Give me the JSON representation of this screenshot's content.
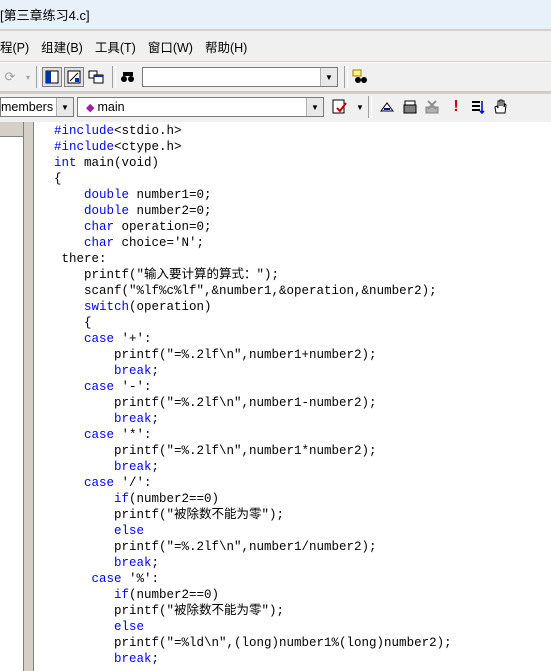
{
  "window": {
    "title": "[第三章练习4.c]"
  },
  "menu": [
    {
      "label": "程(P)"
    },
    {
      "label": "组建(B)"
    },
    {
      "label": "工具(T)"
    },
    {
      "label": "窗口(W)"
    },
    {
      "label": "帮助(H)"
    }
  ],
  "toolbar": {
    "find_combo_value": "",
    "members_combo_value": "members",
    "function_combo_value": "main"
  },
  "code_lines": [
    {
      "indent": "",
      "kw": "#include",
      "rest": "<stdio.h>"
    },
    {
      "indent": "",
      "kw": "#include",
      "rest": "<ctype.h>"
    },
    {
      "indent": "",
      "kw": "int",
      "rest": " main(void)"
    },
    {
      "indent": "",
      "kw": "",
      "rest": "{"
    },
    {
      "indent": "    ",
      "kw": "double",
      "rest": " number1=0;"
    },
    {
      "indent": "    ",
      "kw": "double",
      "rest": " number2=0;"
    },
    {
      "indent": "    ",
      "kw": "char",
      "rest": " operation=0;"
    },
    {
      "indent": "    ",
      "kw": "char",
      "rest": " choice='N';"
    },
    {
      "indent": " ",
      "kw": "",
      "rest": "there:"
    },
    {
      "indent": "    ",
      "kw": "",
      "rest": "printf(\"输入要计算的算式：\");"
    },
    {
      "indent": "    ",
      "kw": "",
      "rest": "scanf(\"%lf%c%lf\",&number1,&operation,&number2);"
    },
    {
      "indent": "    ",
      "kw": "switch",
      "rest": "(operation)"
    },
    {
      "indent": "    ",
      "kw": "",
      "rest": "{"
    },
    {
      "indent": "    ",
      "kw": "case",
      "rest": " '+':"
    },
    {
      "indent": "        ",
      "kw": "",
      "rest": "printf(\"=%.2lf\\n\",number1+number2);"
    },
    {
      "indent": "        ",
      "kw": "break",
      "rest": ";"
    },
    {
      "indent": "    ",
      "kw": "case",
      "rest": " '-':"
    },
    {
      "indent": "        ",
      "kw": "",
      "rest": "printf(\"=%.2lf\\n\",number1-number2);"
    },
    {
      "indent": "        ",
      "kw": "break",
      "rest": ";"
    },
    {
      "indent": "    ",
      "kw": "case",
      "rest": " '*':"
    },
    {
      "indent": "        ",
      "kw": "",
      "rest": "printf(\"=%.2lf\\n\",number1*number2);"
    },
    {
      "indent": "        ",
      "kw": "break",
      "rest": ";"
    },
    {
      "indent": "    ",
      "kw": "case",
      "rest": " '/':"
    },
    {
      "indent": "        ",
      "kw": "if",
      "rest": "(number2==0)"
    },
    {
      "indent": "        ",
      "kw": "",
      "rest": "printf(\"被除数不能为零\");"
    },
    {
      "indent": "        ",
      "kw": "else",
      "rest": ""
    },
    {
      "indent": "        ",
      "kw": "",
      "rest": "printf(\"=%.2lf\\n\",number1/number2);"
    },
    {
      "indent": "        ",
      "kw": "break",
      "rest": ";"
    },
    {
      "indent": "     ",
      "kw": "case",
      "rest": " '%':"
    },
    {
      "indent": "        ",
      "kw": "if",
      "rest": "(number2==0)"
    },
    {
      "indent": "        ",
      "kw": "",
      "rest": "printf(\"被除数不能为零\");"
    },
    {
      "indent": "        ",
      "kw": "else",
      "rest": ""
    },
    {
      "indent": "        ",
      "kw": "",
      "rest": "printf(\"=%ld\\n\",(long)number1%(long)number2);"
    },
    {
      "indent": "        ",
      "kw": "break",
      "rest": ";"
    }
  ]
}
